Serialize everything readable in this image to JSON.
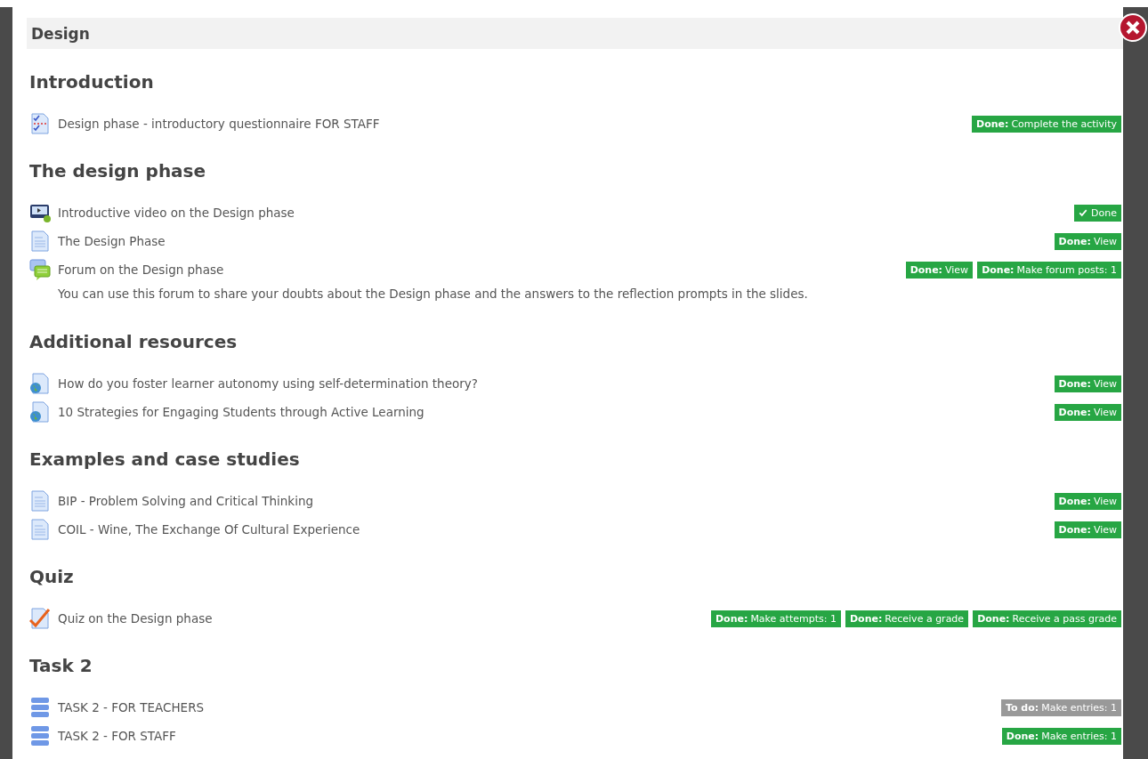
{
  "dialog": {
    "title": "Design"
  },
  "sections": [
    {
      "heading": "Introduction",
      "items": [
        {
          "kind": "questionnaire",
          "title": "Design phase - introductory questionnaire FOR STAFF",
          "badges": [
            {
              "kind": "status",
              "done": true,
              "label": "Done:",
              "text": "Complete the activity"
            }
          ]
        }
      ]
    },
    {
      "heading": "The design phase",
      "items": [
        {
          "kind": "video",
          "title": "Introductive video on the Design phase",
          "badges": [
            {
              "kind": "check",
              "done": true,
              "text": "Done"
            }
          ]
        },
        {
          "kind": "page",
          "title": "The Design Phase",
          "badges": [
            {
              "kind": "status",
              "done": true,
              "label": "Done:",
              "text": "View"
            }
          ]
        },
        {
          "kind": "forum",
          "title": "Forum on the Design phase",
          "description": "You can use this forum to share your doubts about the Design phase and the answers to the reflection prompts in the slides.",
          "badges": [
            {
              "kind": "status",
              "done": true,
              "label": "Done:",
              "text": "View"
            },
            {
              "kind": "status",
              "done": true,
              "label": "Done:",
              "text": "Make forum posts: 1"
            }
          ]
        }
      ]
    },
    {
      "heading": "Additional resources",
      "items": [
        {
          "kind": "url",
          "title": "How do you foster learner autonomy using self-determination theory?",
          "badges": [
            {
              "kind": "status",
              "done": true,
              "label": "Done:",
              "text": "View"
            }
          ]
        },
        {
          "kind": "url",
          "title": "10 Strategies for Engaging Students through Active Learning",
          "badges": [
            {
              "kind": "status",
              "done": true,
              "label": "Done:",
              "text": "View"
            }
          ]
        }
      ]
    },
    {
      "heading": "Examples and case studies",
      "items": [
        {
          "kind": "page",
          "title": "BIP - Problem Solving and Critical Thinking",
          "badges": [
            {
              "kind": "status",
              "done": true,
              "label": "Done:",
              "text": "View"
            }
          ]
        },
        {
          "kind": "page",
          "title": "COIL - Wine, The Exchange Of Cultural Experience",
          "badges": [
            {
              "kind": "status",
              "done": true,
              "label": "Done:",
              "text": "View"
            }
          ]
        }
      ]
    },
    {
      "heading": "Quiz",
      "items": [
        {
          "kind": "quiz",
          "title": "Quiz on the Design phase",
          "badges": [
            {
              "kind": "status",
              "done": true,
              "label": "Done:",
              "text": "Make attempts: 1"
            },
            {
              "kind": "status",
              "done": true,
              "label": "Done:",
              "text": "Receive a grade"
            },
            {
              "kind": "status",
              "done": true,
              "label": "Done:",
              "text": "Receive a pass grade"
            }
          ]
        }
      ]
    },
    {
      "heading": "Task 2",
      "items": [
        {
          "kind": "database",
          "title": "TASK 2 - FOR TEACHERS",
          "badges": [
            {
              "kind": "status",
              "done": false,
              "label": "To do:",
              "text": "Make entries: 1"
            }
          ]
        },
        {
          "kind": "database",
          "title": "TASK 2 - FOR STAFF",
          "badges": [
            {
              "kind": "status",
              "done": true,
              "label": "Done:",
              "text": "Make entries: 1"
            }
          ]
        }
      ]
    }
  ]
}
